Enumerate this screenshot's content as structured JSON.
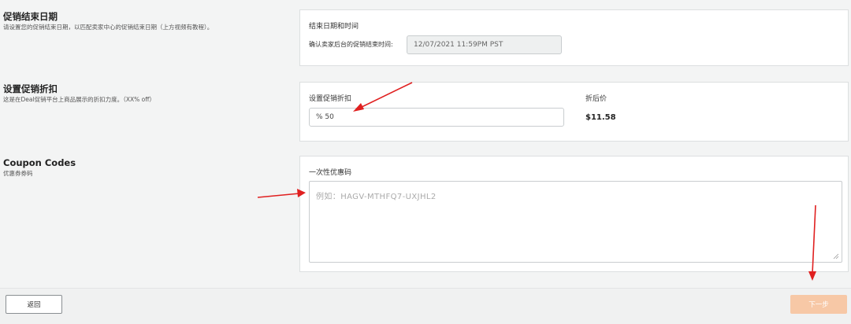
{
  "sections": {
    "end_date": {
      "title": "促销结束日期",
      "desc": "请设置您的促销结束日期，以匹配卖家中心的促销结束日期（上方视频有教程）。",
      "card_label": "结束日期和时间",
      "field_label": "确认卖家后台的促销结束时间:",
      "field_value": "12/07/2021 11:59PM PST"
    },
    "discount": {
      "title": "设置促销折扣",
      "desc": "这是在Deal促销平台上商品展示的折扣力度。（XX% off）",
      "field_label": "设置促销折扣",
      "field_value": "% 50",
      "price_label": "折后价",
      "price_value": "$11.58"
    },
    "coupon": {
      "title": "Coupon Codes",
      "desc": "优惠券券码",
      "field_label": "一次性优惠码",
      "placeholder": "例如：HAGV-MTHFQ7-UXJHL2"
    }
  },
  "footer": {
    "back_label": "返回",
    "next_label": "下一步"
  },
  "colors": {
    "annotation_arrow": "#e02020",
    "next_button": "#f7c8a6"
  }
}
